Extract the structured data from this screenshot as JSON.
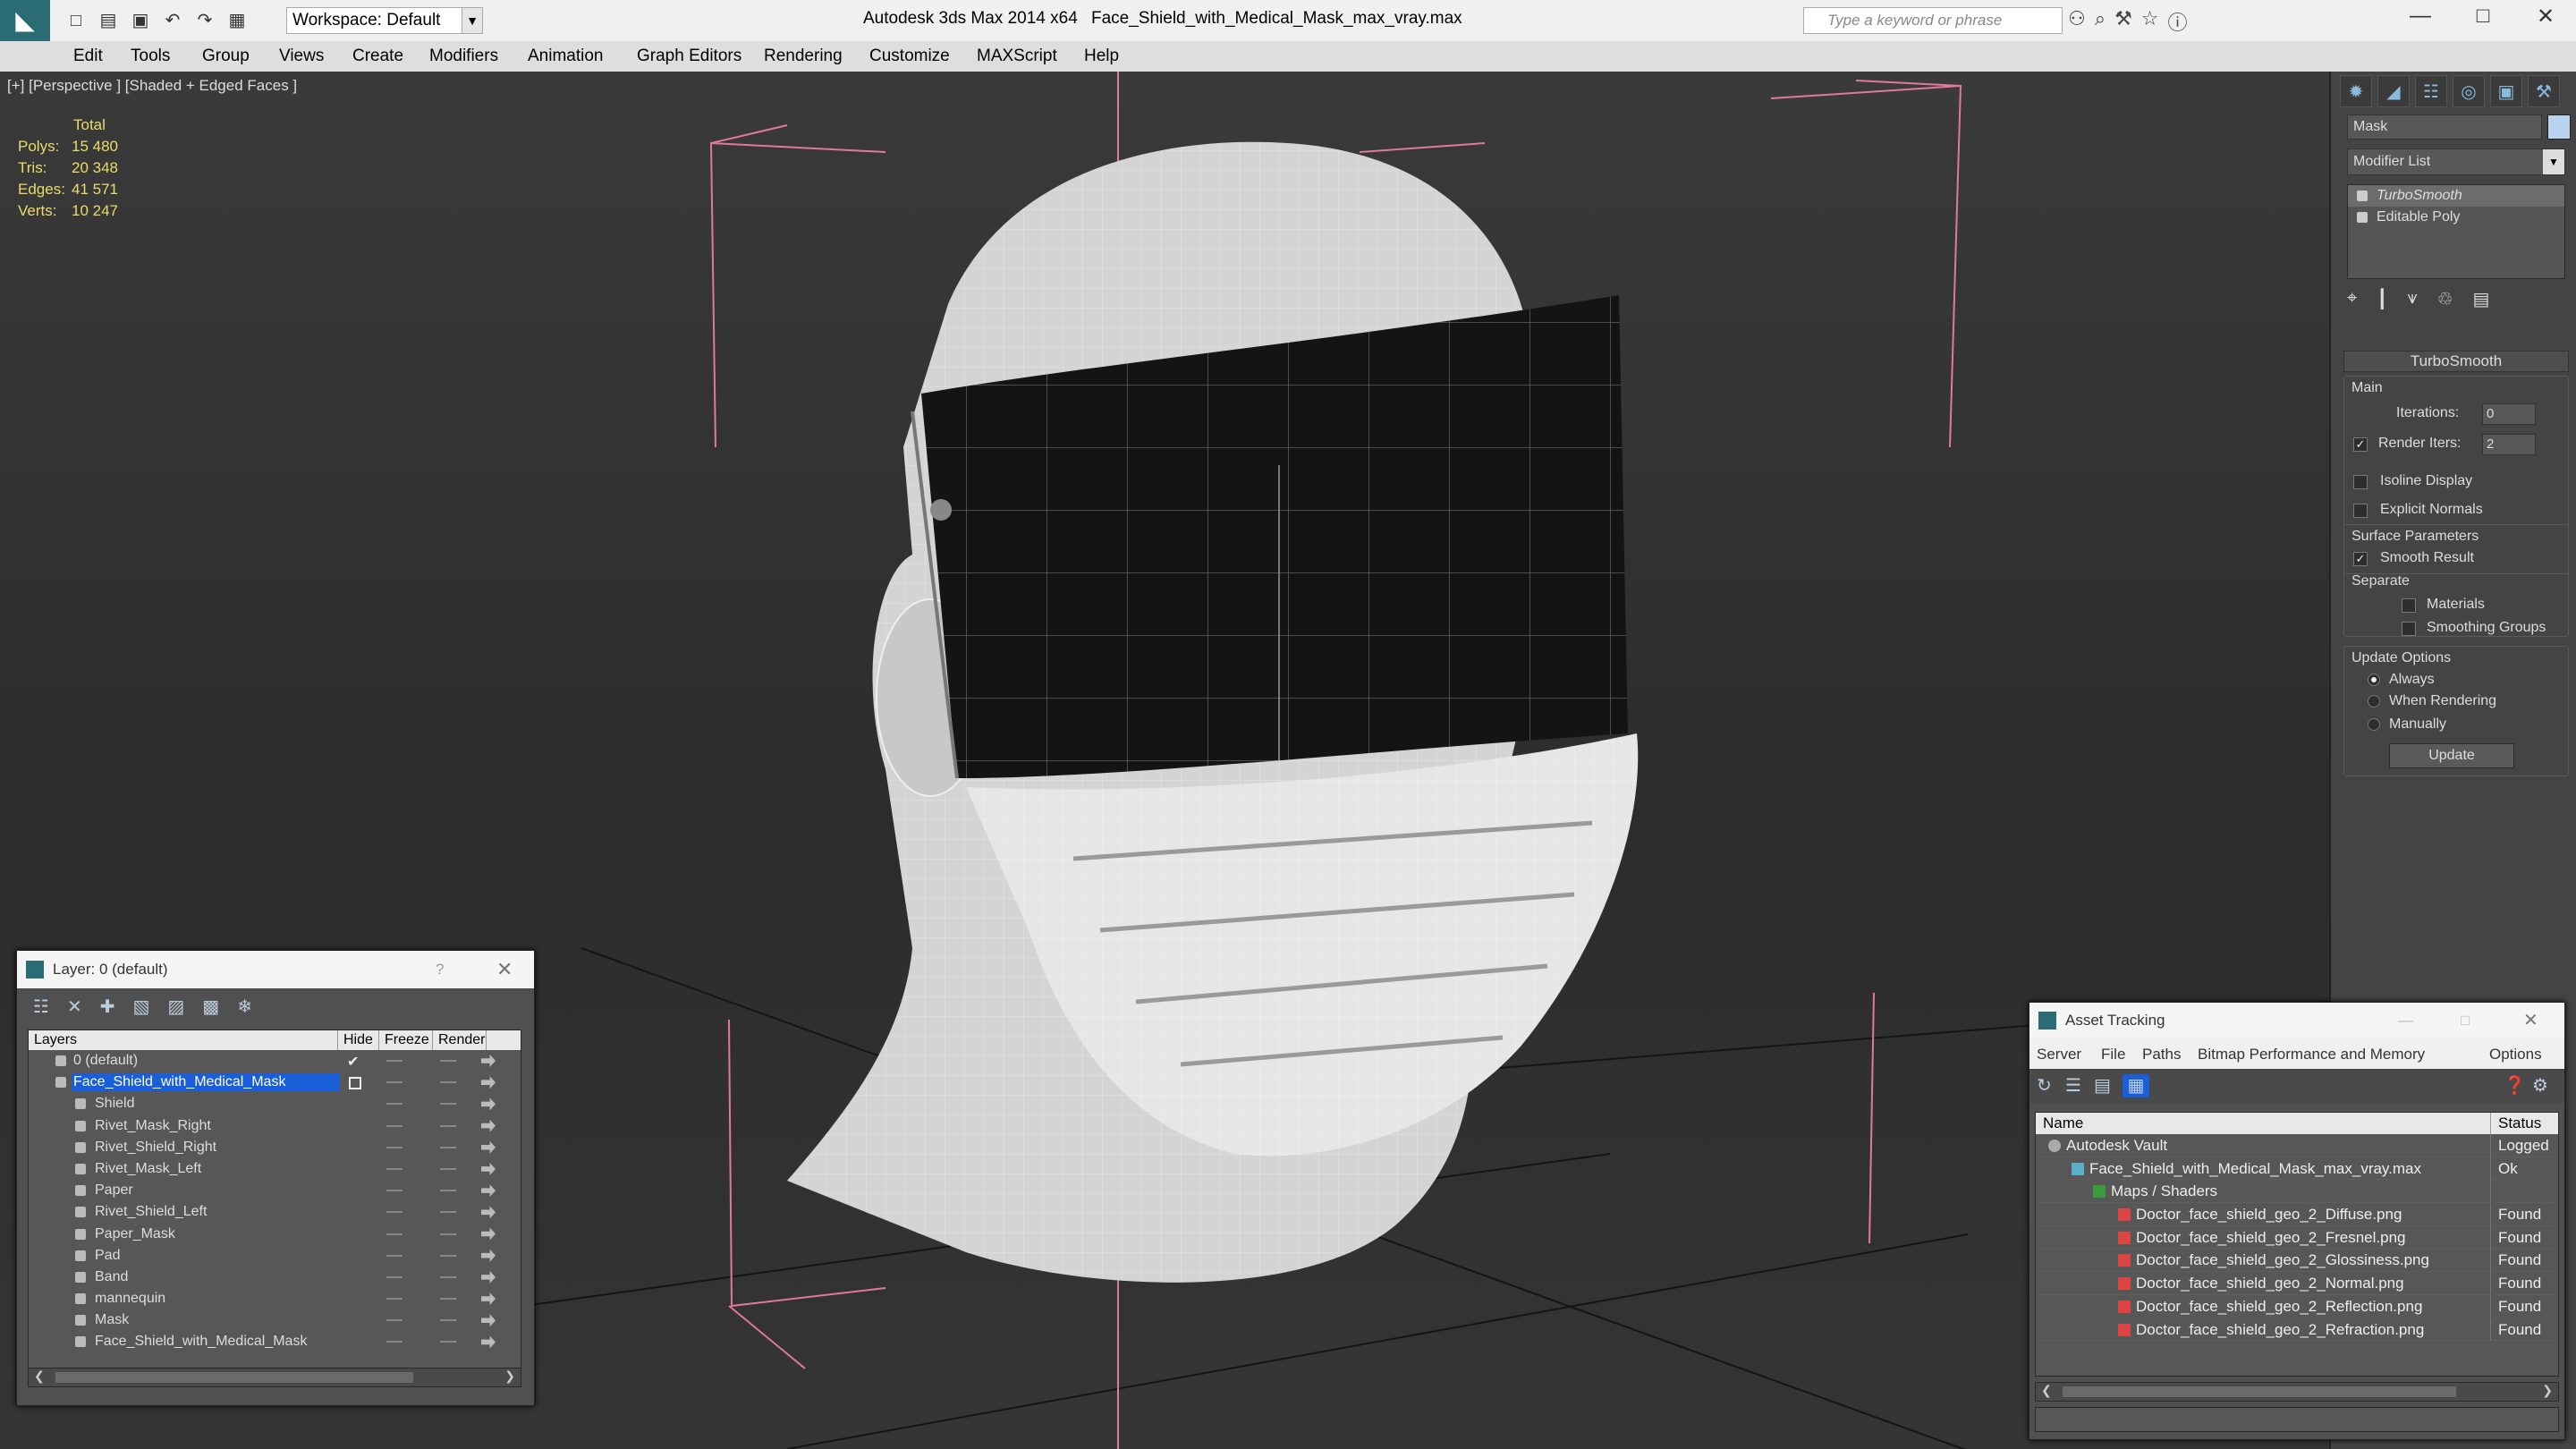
{
  "titlebar": {
    "workspace": "Workspace: Default",
    "app": "Autodesk 3ds Max 2014 x64",
    "file": "Face_Shield_with_Medical_Mask_max_vray.max",
    "search_placeholder": "Type a keyword or phrase"
  },
  "menu": [
    "Edit",
    "Tools",
    "Group",
    "Views",
    "Create",
    "Modifiers",
    "Animation",
    "Graph Editors",
    "Rendering",
    "Customize",
    "MAXScript",
    "Help"
  ],
  "viewport": {
    "label": "[+] [Perspective ] [Shaded + Edged Faces ]",
    "stats": {
      "header": "Total",
      "rows": [
        {
          "k": "Polys:",
          "v": "15 480"
        },
        {
          "k": "Tris:",
          "v": "20 348"
        },
        {
          "k": "Edges:",
          "v": "41 571"
        },
        {
          "k": "Verts:",
          "v": "10 247"
        }
      ]
    }
  },
  "cmd": {
    "object_name": "Mask",
    "modifier_list": "Modifier List",
    "stack": [
      "TurboSmooth",
      "Editable Poly"
    ],
    "rollout": "TurboSmooth",
    "main": "Main",
    "iterations_label": "Iterations:",
    "iterations": "0",
    "render_iters_label": "Render Iters:",
    "render_iters": "2",
    "isoline": "Isoline Display",
    "explicit": "Explicit Normals",
    "surface": "Surface Parameters",
    "smooth": "Smooth Result",
    "separate": "Separate",
    "materials": "Materials",
    "smoothing": "Smoothing Groups",
    "update_opts": "Update Options",
    "always": "Always",
    "when_rendering": "When Rendering",
    "manually": "Manually",
    "update": "Update"
  },
  "layer": {
    "title": "Layer: 0 (default)",
    "q": "?",
    "cols": [
      "Layers",
      "Hide",
      "Freeze",
      "Render"
    ],
    "rows": [
      "0 (default)",
      "Face_Shield_with_Medical_Mask",
      "Shield",
      "Rivet_Mask_Right",
      "Rivet_Shield_Right",
      "Rivet_Mask_Left",
      "Paper",
      "Rivet_Shield_Left",
      "Paper_Mask",
      "Pad",
      "Band",
      "mannequin",
      "Mask",
      "Face_Shield_with_Medical_Mask"
    ]
  },
  "asset": {
    "title": "Asset Tracking",
    "menu": [
      "Server",
      "File",
      "Paths",
      "Bitmap Performance and Memory",
      "Options"
    ],
    "cols": [
      "Name",
      "Status"
    ],
    "rows": [
      {
        "n": "Autodesk Vault",
        "s": "Logged O"
      },
      {
        "n": "Face_Shield_with_Medical_Mask_max_vray.max",
        "s": "Ok"
      },
      {
        "n": "Maps / Shaders",
        "s": ""
      },
      {
        "n": "Doctor_face_shield_geo_2_Diffuse.png",
        "s": "Found"
      },
      {
        "n": "Doctor_face_shield_geo_2_Fresnel.png",
        "s": "Found"
      },
      {
        "n": "Doctor_face_shield_geo_2_Glossiness.png",
        "s": "Found"
      },
      {
        "n": "Doctor_face_shield_geo_2_Normal.png",
        "s": "Found"
      },
      {
        "n": "Doctor_face_shield_geo_2_Reflection.png",
        "s": "Found"
      },
      {
        "n": "Doctor_face_shield_geo_2_Refraction.png",
        "s": "Found"
      }
    ]
  },
  "colors": {
    "stats": "#e9dc6a",
    "selection": "#1a5ed8",
    "brand": "#2a6b74",
    "gizmo": "#e07a9a"
  }
}
